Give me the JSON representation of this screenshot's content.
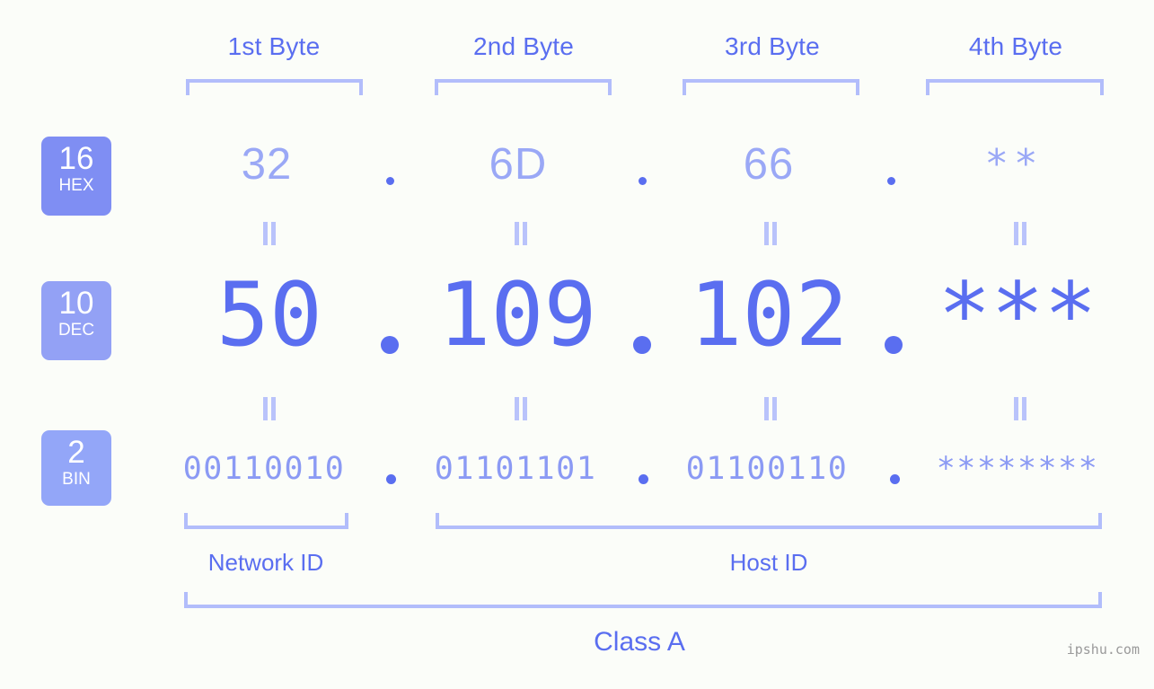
{
  "background_color": "#fbfdf9",
  "colors": {
    "header_blue": "#5a6ef0",
    "bracket_blue": "#b2bdfb",
    "hex_value": "#9aa8f6",
    "dec_value": "#5a6ef0",
    "bin_value": "#8b9af4",
    "badge_hex": "#7f8ef3",
    "badge_dec": "#93a1f5",
    "badge_bin": "#93a6f8",
    "watermark": "#9a9a9a"
  },
  "byte_headers": [
    {
      "label": "1st Byte"
    },
    {
      "label": "2nd Byte"
    },
    {
      "label": "3rd Byte"
    },
    {
      "label": "4th Byte"
    }
  ],
  "bases": [
    {
      "number": "16",
      "abbr": "HEX"
    },
    {
      "number": "10",
      "abbr": "DEC"
    },
    {
      "number": "2",
      "abbr": "BIN"
    }
  ],
  "rows": {
    "hex": {
      "base_number": "16",
      "base_abbr": "HEX",
      "values": [
        "32",
        "6D",
        "66",
        "**"
      ]
    },
    "dec": {
      "base_number": "10",
      "base_abbr": "DEC",
      "values": [
        "50",
        "109",
        "102",
        "***"
      ]
    },
    "bin": {
      "base_number": "2",
      "base_abbr": "BIN",
      "values": [
        "00110010",
        "01101101",
        "01100110",
        "********"
      ]
    }
  },
  "separator": ".",
  "equals_sign": "=",
  "id_sections": [
    {
      "label": "Network ID"
    },
    {
      "label": "Host ID"
    }
  ],
  "class_label": "Class A",
  "watermark": "ipshu.com"
}
